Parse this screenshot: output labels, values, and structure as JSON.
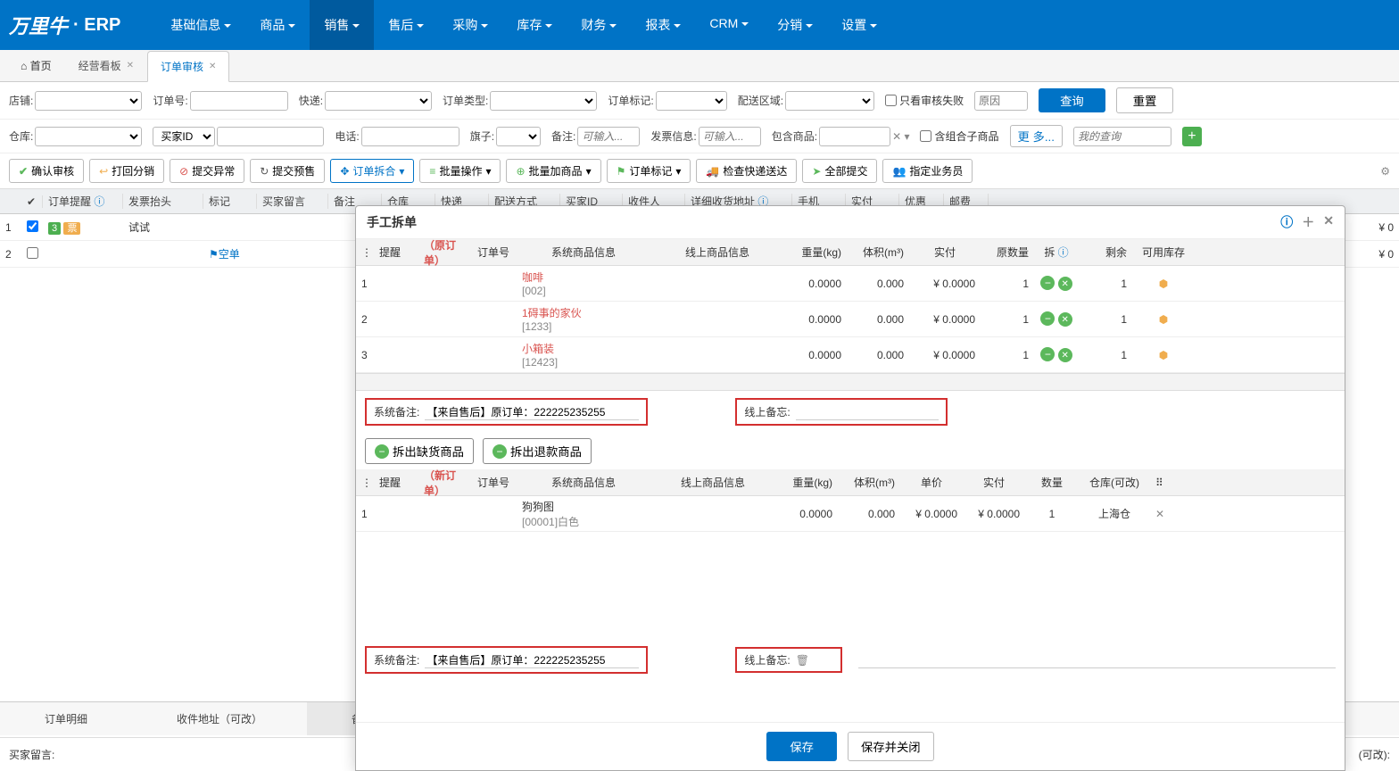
{
  "brand": {
    "logo": "万里牛",
    "suffix": "· ERP"
  },
  "nav": [
    "基础信息",
    "商品",
    "销售",
    "售后",
    "采购",
    "库存",
    "财务",
    "报表",
    "CRM",
    "分销",
    "设置"
  ],
  "nav_active_index": 2,
  "tabs": [
    {
      "label": "首页",
      "home": true
    },
    {
      "label": "经营看板"
    },
    {
      "label": "订单审核",
      "active": true
    }
  ],
  "filters_row1": {
    "shop": "店铺:",
    "orderno": "订单号:",
    "express": "快递:",
    "ordertype": "订单类型:",
    "ordertag": "订单标记:",
    "deliveryarea": "配送区域:",
    "only_fail": "只看审核失败",
    "reason_ph": "原因",
    "query": "查询",
    "reset": "重置"
  },
  "filters_row2": {
    "warehouse": "仓库:",
    "buyerid": "买家ID",
    "phone": "电话:",
    "flag": "旗子:",
    "remark": "备注:",
    "remark_ph": "可输入...",
    "invoice": "发票信息:",
    "invoice_ph": "可输入...",
    "contains_goods": "包含商品:",
    "combo_goods": "含组合子商品",
    "more": "更 多...",
    "my_query_ph": "我的查询"
  },
  "toolbar": {
    "confirm": "确认审核",
    "return": "打回分销",
    "exception": "提交异常",
    "presale": "提交预售",
    "split": "订单拆合",
    "batch": "批量操作",
    "batch_add": "批量加商品",
    "tag": "订单标记",
    "check_express": "检查快递送达",
    "submit_all": "全部提交",
    "assign": "指定业务员"
  },
  "grid": {
    "headers": [
      "",
      "✔",
      "订单提醒",
      "发票抬头",
      "标记",
      "买家留言",
      "备注",
      "仓库",
      "快递",
      "配送方式",
      "买家ID",
      "收件人",
      "详细收货地址",
      "手机",
      "实付",
      "优惠",
      "邮费"
    ],
    "rows": [
      {
        "id": "1",
        "checked": true,
        "badge_num": "3",
        "badge_piao": "票",
        "invoice": "试试",
        "paid": "¥ 0"
      },
      {
        "id": "2",
        "checked": false,
        "tag": "空单",
        "paid": "¥ 0"
      }
    ]
  },
  "bottom_tabs": [
    "订单明细",
    "收件地址（可改）",
    "备注"
  ],
  "bottom_active": 2,
  "bottom_footer": {
    "buyer_msg_label": "买家留言:",
    "right_text": "(可改):"
  },
  "modal": {
    "title": "手工拆单",
    "orig_header": {
      "remind": "提醒",
      "origin": "（原订单）",
      "orderno": "订单号",
      "sys_goods": "系统商品信息",
      "online_goods": "线上商品信息",
      "weight": "重量(kg)",
      "volume": "体积(m³)",
      "paid": "实付",
      "orig_qty": "原数量",
      "split": "拆",
      "remain": "剩余",
      "avail": "可用库存"
    },
    "orig_rows": [
      {
        "idx": "1",
        "name": "咖啡",
        "code": "[002]",
        "weight": "0.0000",
        "volume": "0.000",
        "paid": "¥ 0.0000",
        "qty": "1",
        "remain": "1"
      },
      {
        "idx": "2",
        "name": "1碍事的家伙",
        "code": "[1233]",
        "weight": "0.0000",
        "volume": "0.000",
        "paid": "¥ 0.0000",
        "qty": "1",
        "remain": "1"
      },
      {
        "idx": "3",
        "name": "小箱装",
        "code": "[12423]",
        "weight": "0.0000",
        "volume": "0.000",
        "paid": "¥ 0.0000",
        "qty": "1",
        "remain": "1"
      }
    ],
    "sys_note_label": "系统备注:",
    "sys_note_value": "【来自售后】原订单：222225235255",
    "online_note_label": "线上备忘:",
    "split_btn1": "拆出缺货商品",
    "split_btn2": "拆出退款商品",
    "new_header": {
      "remind": "提醒",
      "neworder": "（新订单）",
      "orderno": "订单号",
      "sys_goods": "系统商品信息",
      "online_goods": "线上商品信息",
      "weight": "重量(kg)",
      "volume": "体积(m³)",
      "unit_price": "单价",
      "paid": "实付",
      "qty": "数量",
      "warehouse": "仓库(可改)"
    },
    "new_rows": [
      {
        "idx": "1",
        "name": "狗狗图",
        "code": "[00001]白色",
        "weight": "0.0000",
        "volume": "0.000",
        "unit_price": "¥ 0.0000",
        "paid": "¥ 0.0000",
        "qty": "1",
        "warehouse": "上海仓"
      }
    ],
    "save": "保存",
    "save_close": "保存并关闭"
  }
}
